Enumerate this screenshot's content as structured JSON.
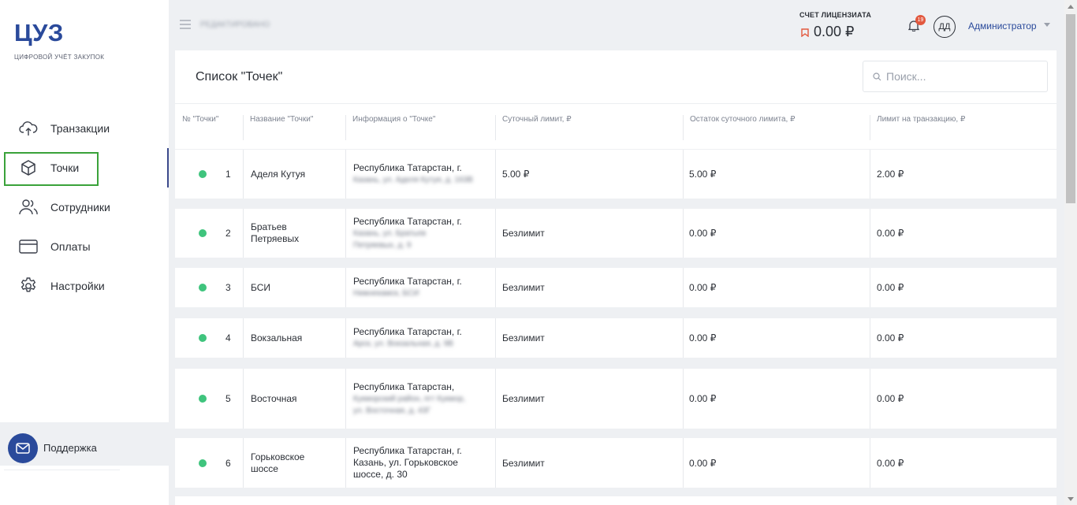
{
  "sidebar": {
    "logo": "ЦУЗ",
    "logo_sub": "ЦИФРОВОЙ УЧЁТ ЗАКУПОК",
    "items": [
      {
        "label": "Транзакции",
        "icon": "cloud-upload-icon"
      },
      {
        "label": "Точки",
        "icon": "cube-icon",
        "active": true
      },
      {
        "label": "Сотрудники",
        "icon": "users-icon"
      },
      {
        "label": "Оплаты",
        "icon": "credit-card-icon"
      },
      {
        "label": "Настройки",
        "icon": "gear-icon"
      }
    ],
    "support": "Поддержка"
  },
  "header": {
    "company": "РЕДАКТИРОВАНО",
    "account_label": "СЧЕТ ЛИЦЕНЗИАТА",
    "account_value": "0.00 ₽",
    "notifications": "19",
    "avatar": "ДД",
    "user": "Администратор"
  },
  "page": {
    "title": "Список \"Точек\"",
    "search_placeholder": "Поиск..."
  },
  "table": {
    "columns": [
      "№ \"Точки\"",
      "Название \"Точки\"",
      "Информация о \"Точке\"",
      "Суточный лимит, ₽",
      "Остаток суточного лимита, ₽",
      "Лимит на транзакцию, ₽"
    ],
    "rows": [
      {
        "n": "1",
        "name": "Аделя Кутуя",
        "info_head": "Республика Татарстан, г.",
        "info_rest": "Казань, ул. Аделя Кутуя, д. 163В",
        "daily": "5.00 ₽",
        "rest": "5.00 ₽",
        "tx": "2.00 ₽"
      },
      {
        "n": "2",
        "name": "Братьев Петряевых",
        "info_head": "Республика Татарстан, г.",
        "info_rest": "Казань, ул. Братьев Петряевых, д. 9",
        "daily": "Безлимит",
        "rest": "0.00 ₽",
        "tx": "0.00 ₽"
      },
      {
        "n": "3",
        "name": "БСИ",
        "info_head": "Республика Татарстан, г.",
        "info_rest": "Нижнекамск, БСИ",
        "daily": "Безлимит",
        "rest": "0.00 ₽",
        "tx": "0.00 ₽"
      },
      {
        "n": "4",
        "name": "Вокзальная",
        "info_head": "Республика Татарстан, г.",
        "info_rest": "Арск, ул. Вокзальная, д. 9В",
        "daily": "Безлимит",
        "rest": "0.00 ₽",
        "tx": "0.00 ₽"
      },
      {
        "n": "5",
        "name": "Восточная",
        "info_head": "Республика Татарстан,",
        "info_rest": "Кукморский район, пгт Кукмор, ул. Восточная, д. 43Г",
        "daily": "Безлимит",
        "rest": "0.00 ₽",
        "tx": "0.00 ₽"
      },
      {
        "n": "6",
        "name": "Горьковское шоссе",
        "info_head": "Республика Татарстан, г.",
        "info_rest": "Казань, ул. Горьковское шоссе, д. 30",
        "daily": "Безлимит",
        "rest": "0.00 ₽",
        "tx": "0.00 ₽"
      }
    ]
  }
}
